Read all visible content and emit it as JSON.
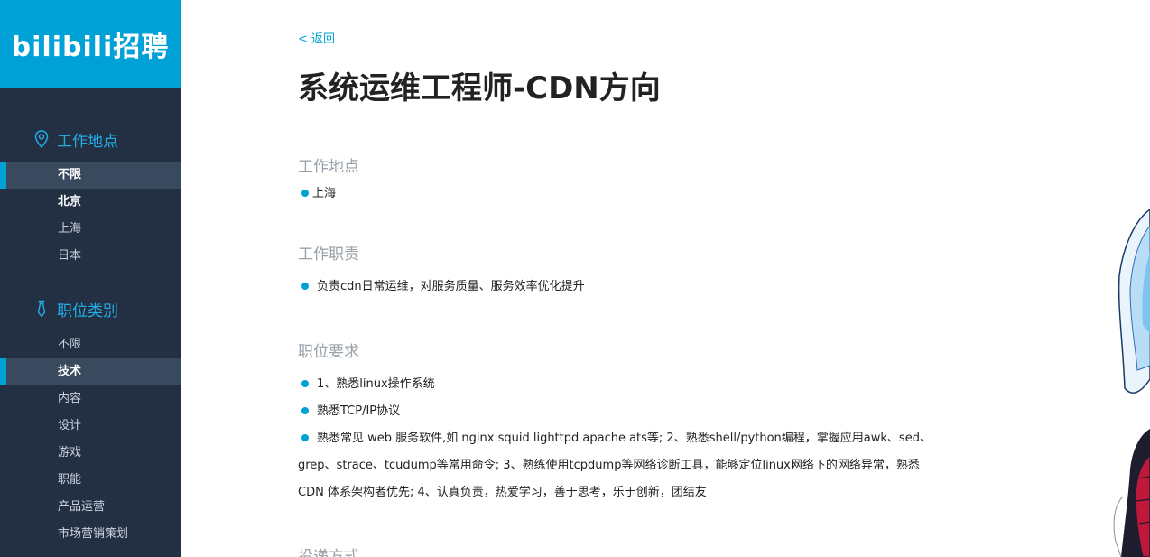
{
  "logo": {
    "text": "bilibili招聘"
  },
  "sidebar": {
    "location": {
      "title": "工作地点",
      "items": [
        {
          "label": "不限",
          "state": "active"
        },
        {
          "label": "北京",
          "state": "bold"
        },
        {
          "label": "上海",
          "state": "normal"
        },
        {
          "label": "日本",
          "state": "normal"
        }
      ]
    },
    "category": {
      "title": "职位类别",
      "items": [
        {
          "label": "不限",
          "state": "normal"
        },
        {
          "label": "技术",
          "state": "active"
        },
        {
          "label": "内容",
          "state": "normal"
        },
        {
          "label": "设计",
          "state": "normal"
        },
        {
          "label": "游戏",
          "state": "normal"
        },
        {
          "label": "职能",
          "state": "normal"
        },
        {
          "label": "产品运营",
          "state": "normal"
        },
        {
          "label": "市场营销策划",
          "state": "normal"
        }
      ]
    }
  },
  "main": {
    "back_label": "< 返回",
    "job_title": "系统运维工程师-CDN方向",
    "sections": {
      "location": {
        "title": "工作地点",
        "items": [
          "上海"
        ]
      },
      "duties": {
        "title": "工作职责",
        "items": [
          "负责cdn日常运维，对服务质量、服务效率优化提升"
        ]
      },
      "requirements": {
        "title": "职位要求",
        "items": [
          "1、熟悉linux操作系统",
          "熟悉TCP/IP协议",
          "熟悉常见 web 服务软件,如 nginx squid lighttpd apache ats等; 2、熟悉shell/python编程，掌握应用awk、sed、grep、strace、tcudump等常用命令; 3、熟练使用tcpdump等网络诊断工具，能够定位linux网络下的网络异常，熟悉 CDN 体系架构者优先; 4、认真负责，热爱学习，善于思考，乐于创新，团结友"
        ]
      },
      "apply": {
        "title": "投递方式"
      }
    }
  },
  "colors": {
    "brand": "#00a1d6",
    "sidebar_bg": "#233044",
    "accent_text": "#23ade5"
  }
}
